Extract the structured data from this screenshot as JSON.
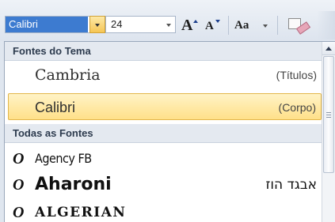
{
  "toolbar": {
    "font_name": "Calibri",
    "font_size": "24",
    "grow_font_label": "A",
    "shrink_font_label": "A",
    "change_case_label": "Aa"
  },
  "dropdown": {
    "theme_section_title": "Fontes do Tema",
    "theme_fonts": [
      {
        "name": "Cambria",
        "tag": "(Títulos)"
      },
      {
        "name": "Calibri",
        "tag": "(Corpo)"
      }
    ],
    "selected_theme_font": "Calibri",
    "all_section_title": "Todas as Fontes",
    "all_fonts": [
      {
        "name": "Agency FB",
        "sample": ""
      },
      {
        "name": "Aharoni",
        "sample": "אבגד הוז"
      },
      {
        "name": "ALGERIAN",
        "sample": ""
      }
    ]
  },
  "icons": {
    "font_type_icon": "opentype-o-icon",
    "dropdown_arrow": "chevron-down-icon",
    "clear_formatting": "eraser-icon"
  },
  "colors": {
    "selection_fill": "#ffe089",
    "selection_border": "#e3b64a",
    "font_field_highlight": "#3d7bd0"
  }
}
